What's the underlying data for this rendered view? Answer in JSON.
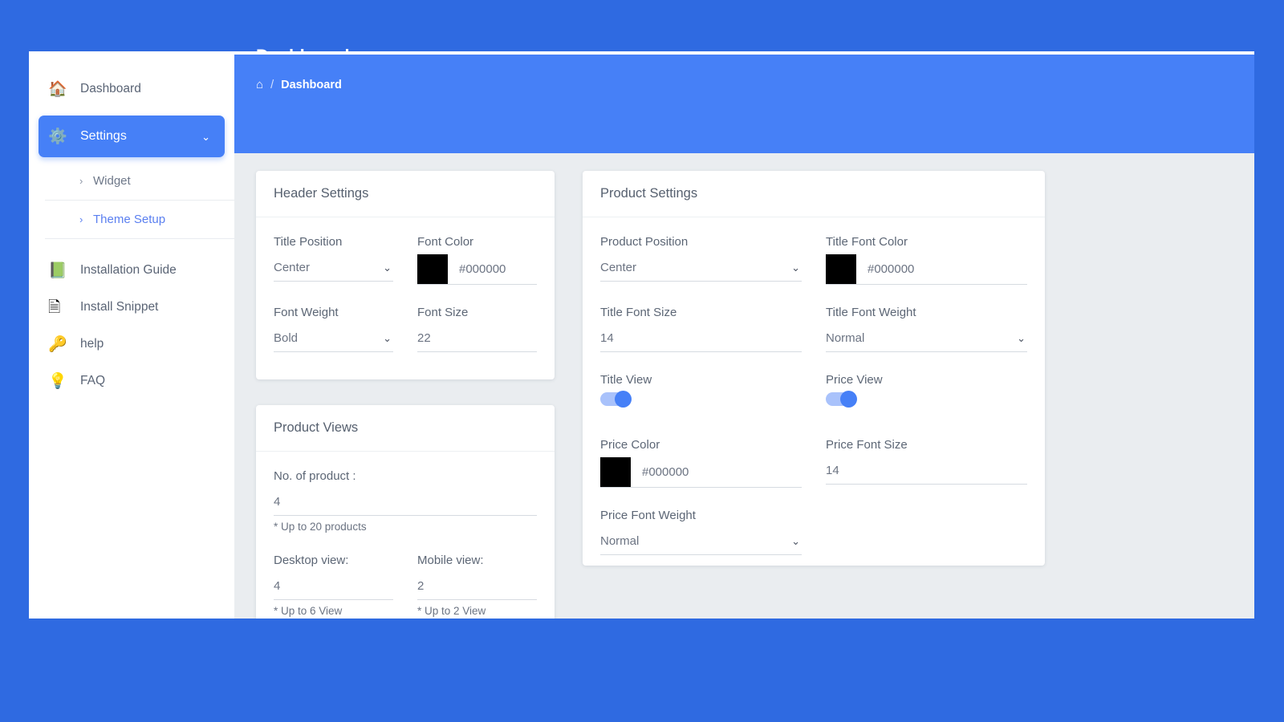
{
  "page": {
    "title": "Dashboard",
    "accent": "#4680f7",
    "page_bg": "#2f6ae1",
    "content_bg": "#eaedf0"
  },
  "breadcrumb": {
    "home_icon": "home-icon",
    "separator": "/",
    "current": "Dashboard"
  },
  "sidebar": {
    "items": [
      {
        "label": "Dashboard",
        "icon": "house-icon"
      },
      {
        "label": "Settings",
        "icon": "gears-icon",
        "chevron": "chevron-down-icon"
      },
      {
        "label": "Widget",
        "icon": "chevron-right-icon"
      },
      {
        "label": "Theme Setup",
        "icon": "chevron-right-icon"
      },
      {
        "label": "Installation Guide",
        "icon": "green-book-icon"
      },
      {
        "label": "Install Snippet",
        "icon": "code-file-icon"
      },
      {
        "label": "help",
        "icon": "key-icon"
      },
      {
        "label": "FAQ",
        "icon": "lightbulb-icon"
      }
    ]
  },
  "header_settings": {
    "card_title": "Header Settings",
    "title_position": {
      "label": "Title Position",
      "value": "Center"
    },
    "font_color": {
      "label": "Font Color",
      "value": "#000000",
      "swatch": "#000000"
    },
    "font_weight": {
      "label": "Font Weight",
      "value": "Bold"
    },
    "font_size": {
      "label": "Font Size",
      "value": "22"
    }
  },
  "product_views": {
    "card_title": "Product Views",
    "no_of_product": {
      "label": "No. of product :",
      "value": "4",
      "hint": "* Up to 20 products"
    },
    "desktop_view": {
      "label": "Desktop view:",
      "value": "4",
      "hint": "* Up to 6 View"
    },
    "mobile_view": {
      "label": "Mobile view:",
      "value": "2",
      "hint": "* Up to 2 View"
    }
  },
  "product_settings": {
    "card_title": "Product Settings",
    "product_position": {
      "label": "Product Position",
      "value": "Center"
    },
    "title_font_color": {
      "label": "Title Font Color",
      "value": "#000000",
      "swatch": "#000000"
    },
    "title_font_size": {
      "label": "Title Font Size",
      "value": "14"
    },
    "title_font_weight": {
      "label": "Title Font Weight",
      "value": "Normal"
    },
    "title_view": {
      "label": "Title View",
      "state": "on"
    },
    "price_view": {
      "label": "Price View",
      "state": "on"
    },
    "price_color": {
      "label": "Price Color",
      "value": "#000000",
      "swatch": "#000000"
    },
    "price_font_size": {
      "label": "Price Font Size",
      "value": "14"
    },
    "price_font_weight": {
      "label": "Price Font Weight",
      "value": "Normal"
    }
  },
  "glyphs": {
    "chevron_down": "⌄",
    "chevron_right": "›",
    "home": "⌂",
    "house": "🏠",
    "gears": "⚙",
    "book": "📗",
    "code": "🗎",
    "key": "🔑",
    "bulb": "💡",
    "slash": "/"
  }
}
